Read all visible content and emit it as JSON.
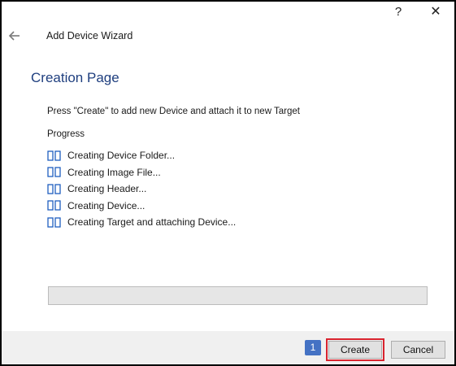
{
  "window": {
    "help_label": "?",
    "close_label": "✕"
  },
  "header": {
    "back_icon": "back-arrow-icon",
    "wizard_title": "Add Device Wizard"
  },
  "main": {
    "page_title": "Creation Page",
    "instruction": "Press \"Create\" to add new Device and attach it to new Target",
    "progress_label": "Progress",
    "progress_value": 0,
    "steps": [
      {
        "label": "Creating Device Folder...",
        "icon": "pending-step-icon"
      },
      {
        "label": "Creating Image File...",
        "icon": "pending-step-icon"
      },
      {
        "label": "Creating Header...",
        "icon": "pending-step-icon"
      },
      {
        "label": "Creating Device...",
        "icon": "pending-step-icon"
      },
      {
        "label": "Creating Target and attaching Device...",
        "icon": "pending-step-icon"
      }
    ]
  },
  "footer": {
    "badge": "1",
    "create_label": "Create",
    "cancel_label": "Cancel"
  },
  "colors": {
    "title_blue": "#1f3f7f",
    "icon_blue": "#1f5fbf",
    "badge_blue": "#4472c4",
    "highlight_red": "#d9232e"
  }
}
